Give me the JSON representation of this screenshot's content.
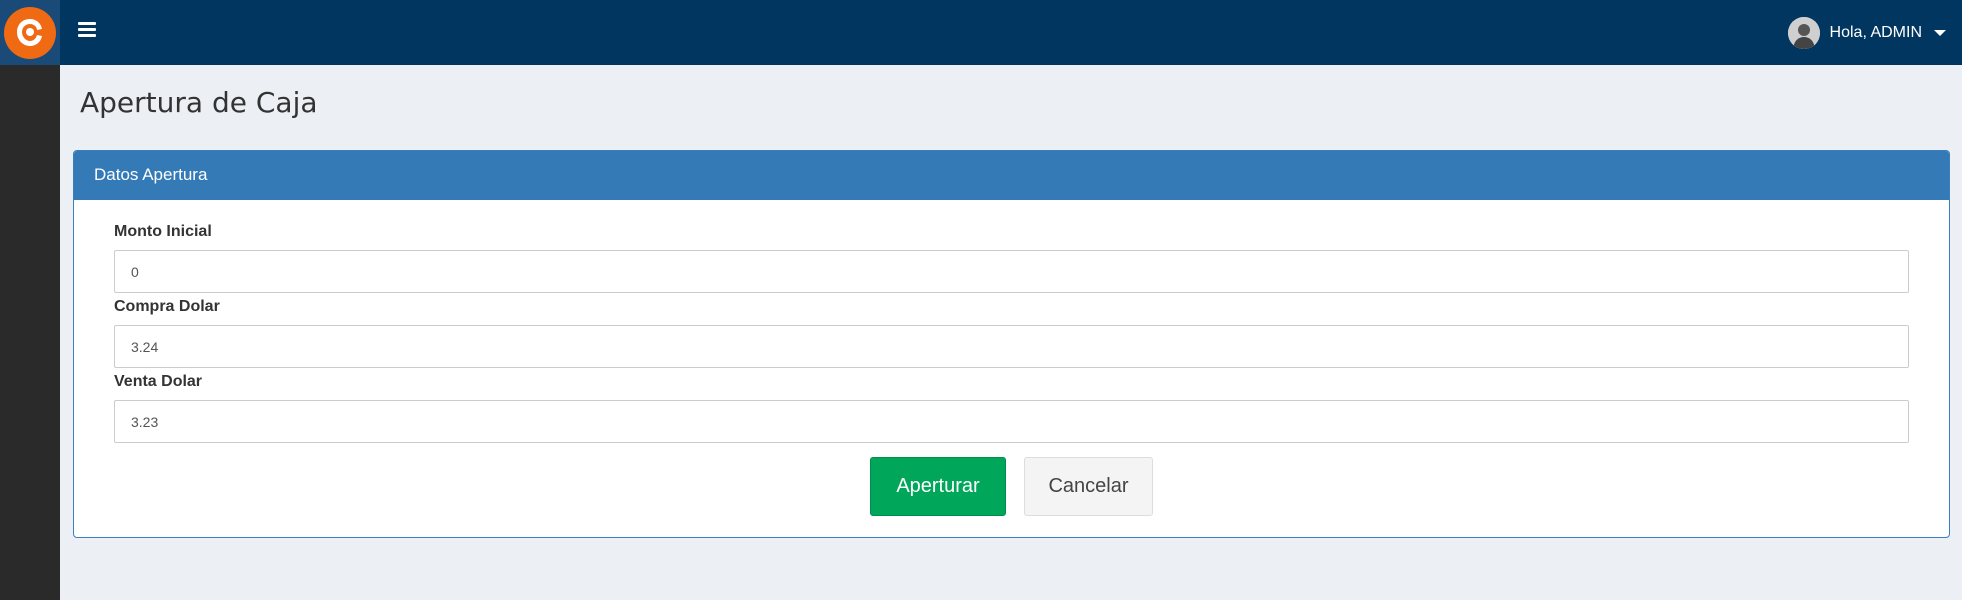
{
  "header": {
    "menu_icon": "hamburger-icon",
    "user_greeting": "Hola, ADMIN"
  },
  "page": {
    "title": "Apertura de Caja"
  },
  "panel": {
    "heading": "Datos Apertura",
    "fields": [
      {
        "label": "Monto Inicial",
        "value": "0"
      },
      {
        "label": "Compra Dolar",
        "value": "3.24"
      },
      {
        "label": "Venta Dolar",
        "value": "3.23"
      }
    ],
    "buttons": {
      "submit": "Aperturar",
      "cancel": "Cancelar"
    }
  },
  "colors": {
    "topbar": "#003660",
    "panel_heading": "#337ab7",
    "primary_button": "#00a65a",
    "logo": "#f06a13"
  }
}
